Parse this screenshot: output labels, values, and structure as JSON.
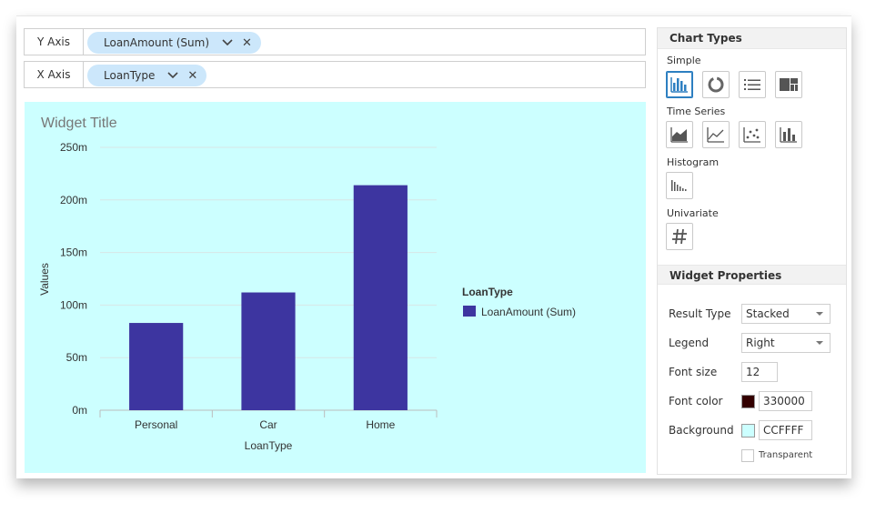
{
  "y_axis": {
    "label": "Y Axis",
    "chip_label": "LoanAmount (Sum)"
  },
  "x_axis": {
    "label": "X Axis",
    "chip_label": "LoanType"
  },
  "widget": {
    "title": "Widget Title",
    "background": "#CCFFFF"
  },
  "chart_data": {
    "type": "bar",
    "title": "Widget Title",
    "categories": [
      "Personal",
      "Car",
      "Home"
    ],
    "series": [
      {
        "name": "LoanAmount (Sum)",
        "values": [
          83,
          112,
          214
        ],
        "color": "#3d35a0"
      }
    ],
    "xlabel": "LoanType",
    "ylabel": "Values",
    "ylim": [
      0,
      250
    ],
    "yticks": [
      0,
      50,
      100,
      150,
      200,
      250
    ],
    "ytick_labels": [
      "0m",
      "50m",
      "100m",
      "150m",
      "200m",
      "250m"
    ],
    "grid": true,
    "legend": {
      "title": "LoanType",
      "placement": "right"
    }
  },
  "side": {
    "chart_types_title": "Chart Types",
    "simple_label": "Simple",
    "time_series_label": "Time Series",
    "histogram_label": "Histogram",
    "univariate_label": "Univariate",
    "props_title": "Widget Properties",
    "result_type_label": "Result Type",
    "result_type_value": "Stacked",
    "legend_label": "Legend",
    "legend_value": "Right",
    "font_size_label": "Font size",
    "font_size_value": "12",
    "font_color_label": "Font color",
    "font_color_value": "330000",
    "font_color_hex": "#330000",
    "background_label": "Background",
    "background_value": "CCFFFF",
    "background_hex": "#CCFFFF",
    "transparent_label": "Transparent"
  },
  "colors": {
    "accent": "#2d7fc1",
    "chip": "#cce7fb",
    "bar": "#3d35a0"
  }
}
